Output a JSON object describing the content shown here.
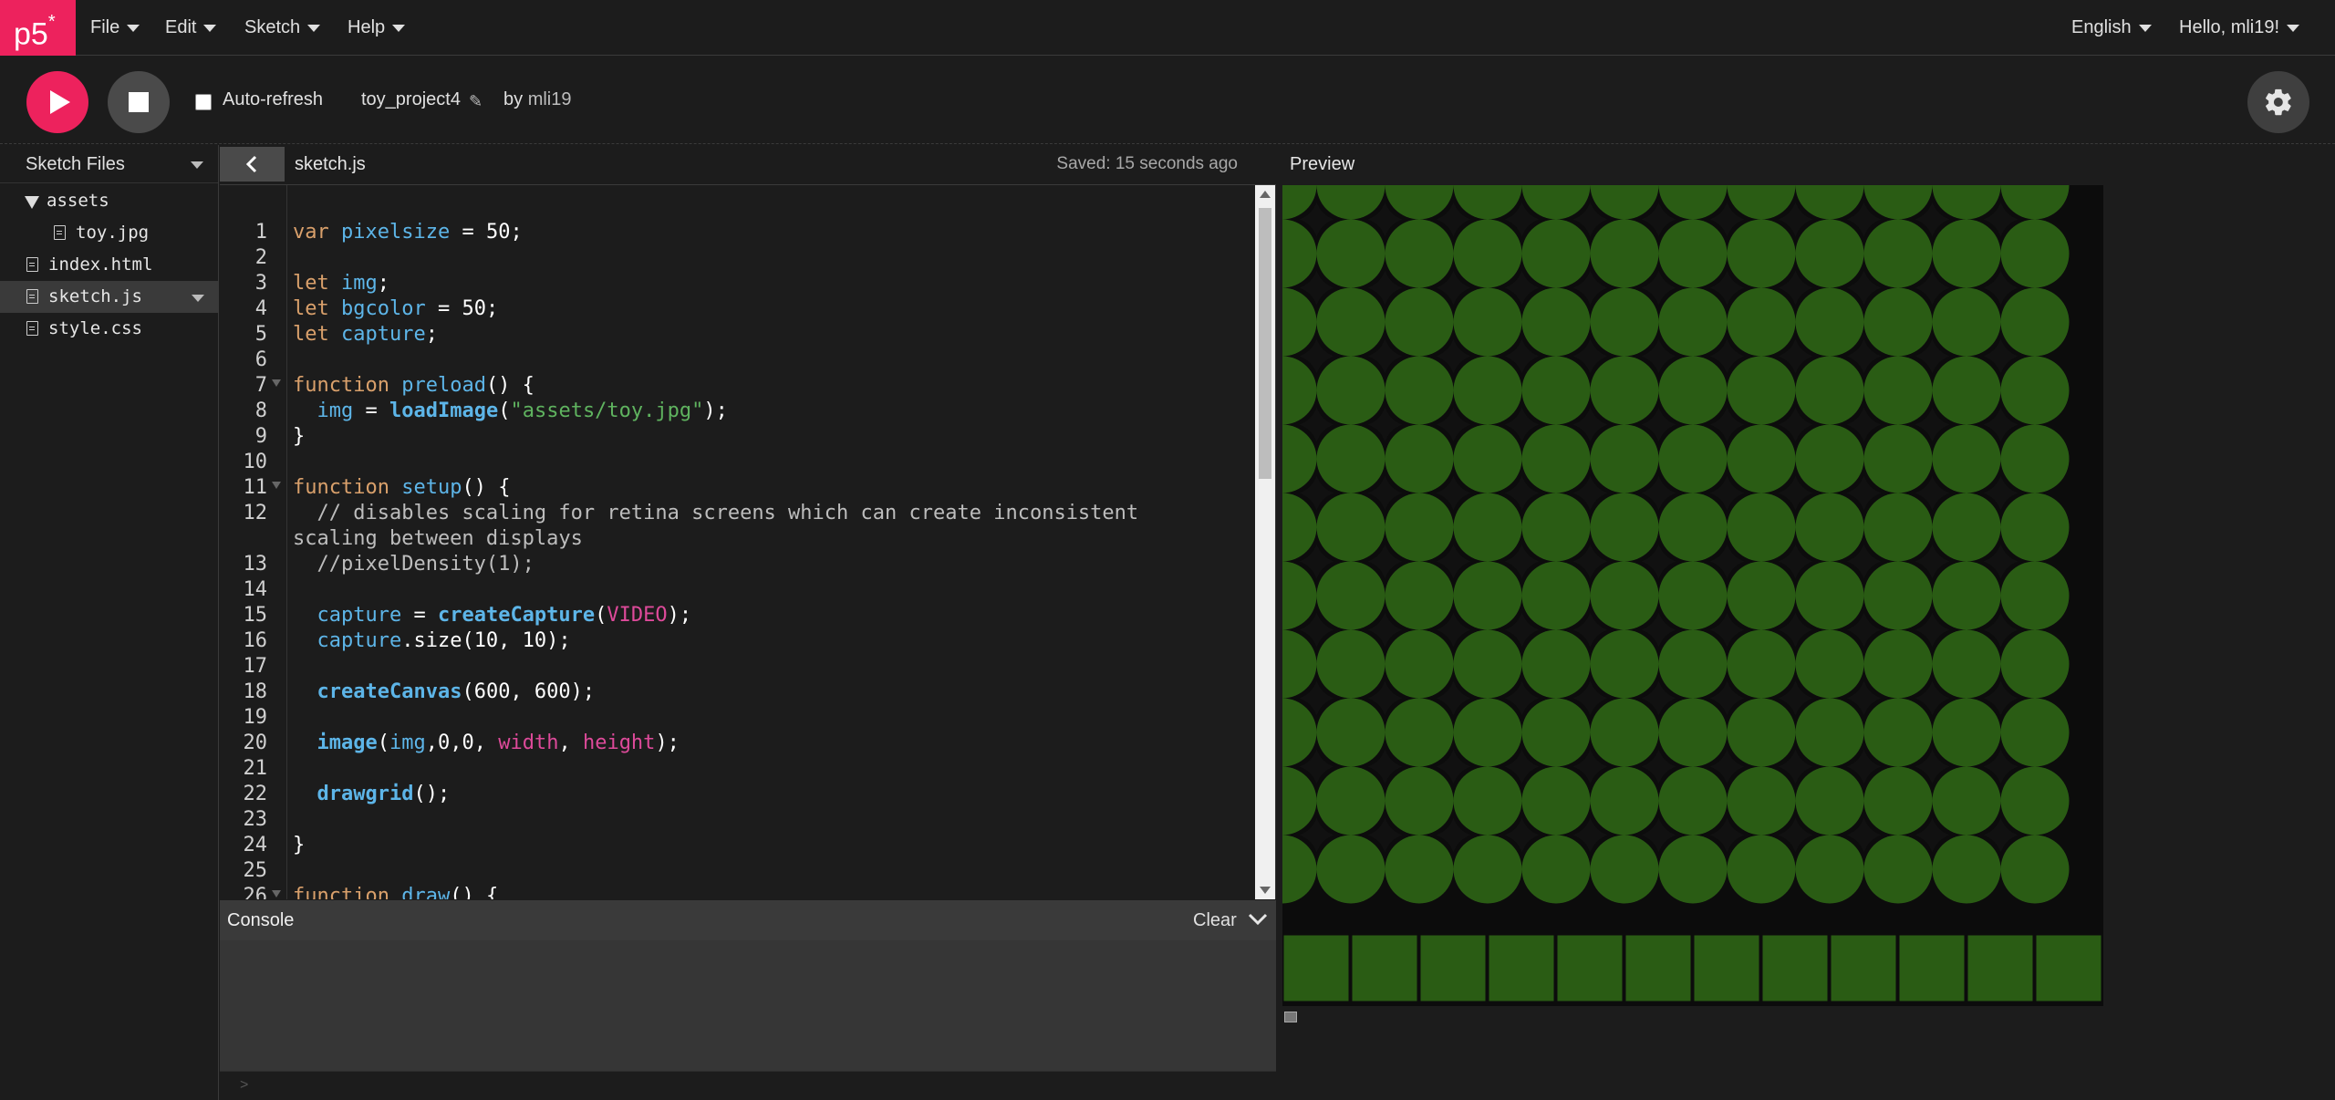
{
  "nav": {
    "logo": "p5",
    "logo_star": "*",
    "menus": [
      {
        "label": "File"
      },
      {
        "label": "Edit"
      },
      {
        "label": "Sketch"
      },
      {
        "label": "Help"
      }
    ],
    "language": "English",
    "user_greeting": "Hello, mli19!"
  },
  "toolbar": {
    "play_icon": "play-icon",
    "stop_icon": "stop-icon",
    "auto_refresh_label": "Auto-refresh",
    "auto_refresh_checked": false,
    "project_name": "toy_project4",
    "by_label": "by",
    "owner": "mli19",
    "settings_icon": "gear-icon"
  },
  "sidebar": {
    "title": "Sketch Files",
    "files": [
      {
        "name": "assets",
        "type": "folder",
        "expanded": true
      },
      {
        "name": "toy.jpg",
        "type": "file",
        "indent": 1
      },
      {
        "name": "index.html",
        "type": "file"
      },
      {
        "name": "sketch.js",
        "type": "file",
        "selected": true
      },
      {
        "name": "style.css",
        "type": "file"
      }
    ]
  },
  "editor": {
    "tab": "sketch.js",
    "saved_status": "Saved: 15 seconds ago",
    "line_numbers": [
      "1",
      "2",
      "3",
      "4",
      "5",
      "6",
      "7",
      "8",
      "9",
      "10",
      "11",
      "12",
      "13",
      "14",
      "15",
      "16",
      "17",
      "18",
      "19",
      "20",
      "21",
      "22",
      "23",
      "24",
      "25",
      "26"
    ],
    "lines": [
      "var pixelsize = 50;",
      "",
      "let img;",
      "let bgcolor = 50;",
      "let capture;",
      "",
      "function preload() {",
      "  img = loadImage(\"assets/toy.jpg\");",
      "}",
      "",
      "function setup() {",
      "  // disables scaling for retina screens which can create inconsistent",
      "scaling between displays",
      "  //pixelDensity(1);",
      "",
      "  capture = createCapture(VIDEO);",
      "  capture.size(10, 10);",
      "",
      "  createCanvas(600, 600);",
      "",
      "  image(img,0,0, width, height);",
      "",
      "  drawgrid();",
      "",
      "}",
      "",
      "function draw() {"
    ]
  },
  "console": {
    "title": "Console",
    "clear_label": "Clear",
    "prompt": ">"
  },
  "preview": {
    "title": "Preview",
    "colors": {
      "circle": "#2a5c14",
      "background": "#0c0c0c",
      "star": "#111111",
      "grid_square": "#2a5c14",
      "grid_line": "#0c0c0c"
    },
    "circle_grid": {
      "cols": 12,
      "rows": 11
    },
    "star_grid": {
      "cols": 11,
      "rows": 10
    },
    "square_row_count": 12
  }
}
